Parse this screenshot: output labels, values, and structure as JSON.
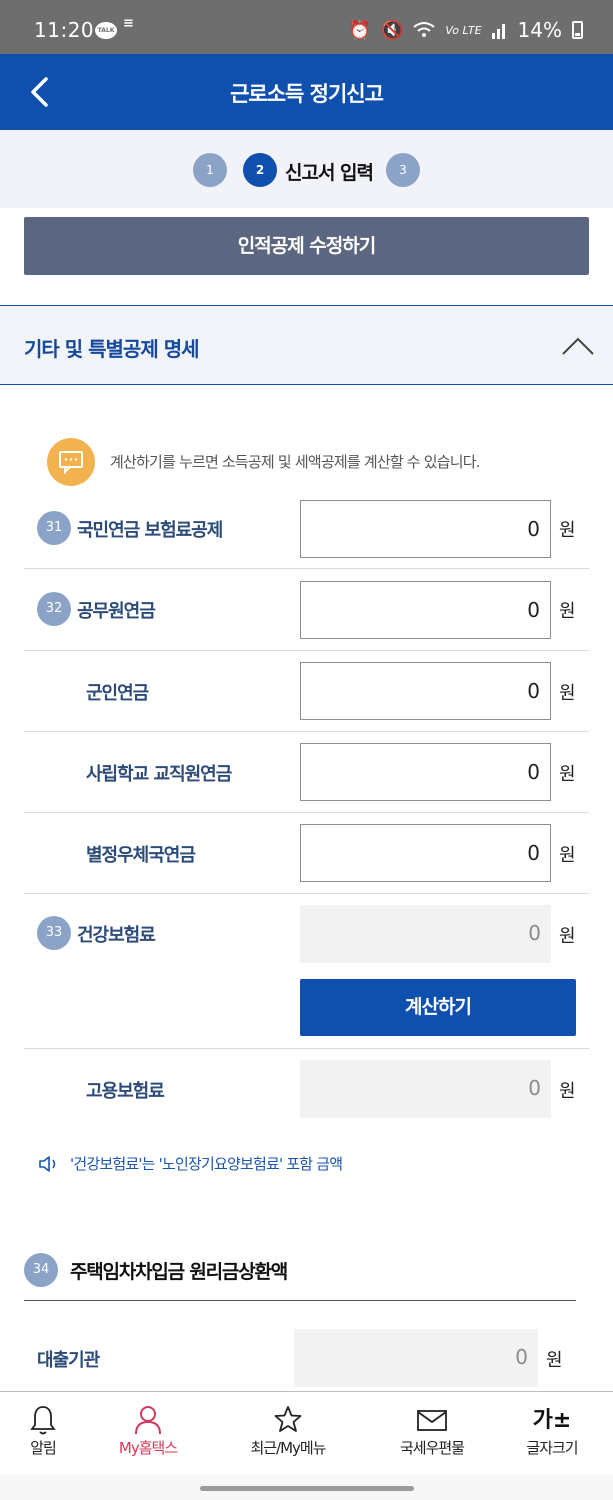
{
  "status_bar": {
    "time": "11:20",
    "talk_badge": "TALK",
    "dnd_glyph": "≡",
    "lte": "Vo LTE",
    "battery": "14%"
  },
  "header": {
    "title": "근로소득 정기신고"
  },
  "steps": {
    "step1": "1",
    "step2": "2",
    "step2_label": "신고서 입력",
    "step3": "3"
  },
  "edit_button_label": "인적공제 수정하기",
  "section": {
    "title": "기타 및 특별공제 명세",
    "notice": "계산하기를 누르면 소득공제 및 세액공제를 계산할 수 있습니다."
  },
  "fields": [
    {
      "num": "31",
      "label": "국민연금 보험료공제",
      "value": "0",
      "unit": "원"
    },
    {
      "num": "32",
      "label": "공무원연금",
      "value": "0",
      "unit": "원"
    },
    {
      "num": "",
      "label": "군인연금",
      "value": "0",
      "unit": "원"
    },
    {
      "num": "",
      "label": "사립학교 교직원연금",
      "value": "0",
      "unit": "원"
    },
    {
      "num": "",
      "label": "별정우체국연금",
      "value": "0",
      "unit": "원"
    },
    {
      "num": "33",
      "label": "건강보험료",
      "value": "0",
      "unit": "원"
    },
    {
      "num": "",
      "label": "고용보험료",
      "value": "0",
      "unit": "원"
    }
  ],
  "calc_button_label": "계산하기",
  "note": "'건강보험료'는 '노인장기요양보험료' 포함 금액",
  "subsection": {
    "num": "34",
    "title": "주택임차차입금 원리금상환액",
    "field_label": "대출기관",
    "field_value": "0",
    "field_unit": "원"
  },
  "bottom_nav": [
    {
      "label": "알림",
      "icon": "bell-icon"
    },
    {
      "label": "My홈택스",
      "icon": "person-icon"
    },
    {
      "label": "최근/My메뉴",
      "icon": "star-icon"
    },
    {
      "label": "국세우편물",
      "icon": "mail-icon"
    },
    {
      "label": "글자크기",
      "icon": "font-size-icon",
      "glyph": "가±"
    }
  ],
  "colors": {
    "primary": "#0f4fae",
    "badge": "#8aa3c7",
    "notice_icon": "#f2b24f",
    "active_nav": "#d13a5a",
    "edit_button": "#5b6780"
  }
}
